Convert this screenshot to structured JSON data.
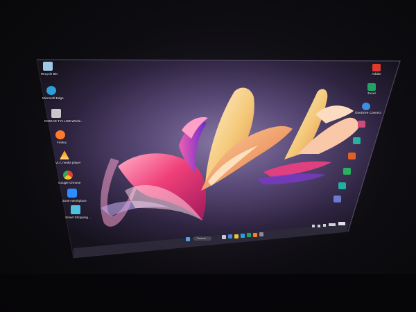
{
  "desktop": {
    "left_icons": [
      {
        "icon": "recycle-bin-icon",
        "label": "Recycle Bin",
        "color": "#9fc8e8"
      },
      {
        "icon": "edge-icon",
        "label": "Microsoft Edge",
        "color": "#2aa0d8"
      },
      {
        "icon": "driver-app-icon",
        "label": "IOGEAR TYx USB Wirele...",
        "color": "#c9c9c9"
      },
      {
        "icon": "firefox-icon",
        "label": "Firefox",
        "color": "#ff7a2a"
      },
      {
        "icon": "vlc-icon",
        "label": "VLC media player",
        "color": "#ff8c00"
      },
      {
        "icon": "chrome-icon",
        "label": "Google Chrome",
        "color": "#f2c230"
      },
      {
        "icon": "zoom-icon",
        "label": "Zoom Workplace",
        "color": "#2d8cff"
      },
      {
        "icon": "app-icon",
        "label": "Smart Shopping ...",
        "color": "#4fc0e0"
      }
    ],
    "right_icons": [
      {
        "icon": "adobe-icon",
        "label": "Adobe",
        "color": "#e03a2a"
      },
      {
        "icon": "excel-icon",
        "label": "Excel",
        "color": "#21a366"
      },
      {
        "icon": "onedrive-icon",
        "label": "OneDrive Connect",
        "color": "#3a8fe0"
      },
      {
        "icon": "app-icon",
        "label": "",
        "color": "#d04a7a"
      },
      {
        "icon": "app-icon",
        "label": "",
        "color": "#2ab0a0"
      },
      {
        "icon": "powerpoint-icon",
        "label": "",
        "color": "#e0602a"
      },
      {
        "icon": "app-icon",
        "label": "",
        "color": "#2ab060"
      },
      {
        "icon": "app-icon",
        "label": "",
        "color": "#20b0a0"
      },
      {
        "icon": "app-icon",
        "label": "",
        "color": "#6a7ad0"
      }
    ]
  },
  "taskbar": {
    "search_label": "Search",
    "color": "#3a3a4a"
  },
  "colors": {
    "monitor_glow": "#6b5a86",
    "wallpaper_bg": "#3a2f52"
  }
}
